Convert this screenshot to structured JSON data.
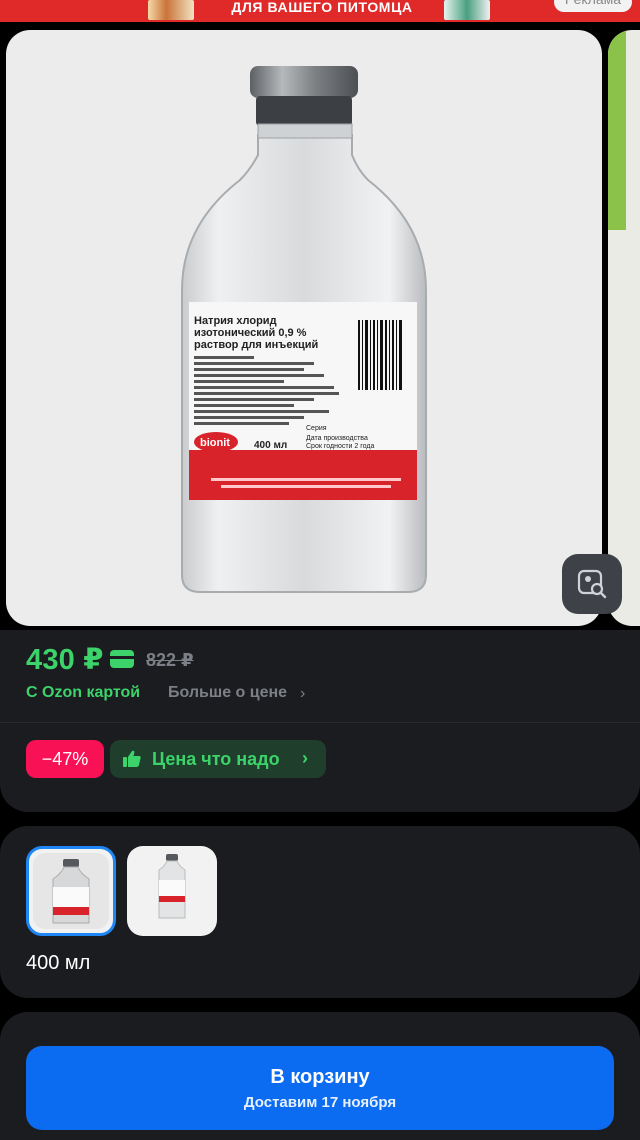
{
  "ad_banner": {
    "text": "ДЛЯ ВАШЕГО ПИТОМЦА",
    "label": "Реклама"
  },
  "product_image": {
    "label_title": "Натрия хлорид изотонический 0,9 % раствор для инъекций",
    "label_lines": [
      "МНН натрия хлорид",
      "Для внутривенного и подкожного введения",
      "Для ветеринарного применения",
      "Стерильно",
      "100 мл содержит: ДВ - натрия хлорид - 0,9 г",
      "и воду для инъекций до 100 мл",
      "Отпускается без рецепта ветеринарного врача"
    ],
    "brand": "bionit",
    "volume": "400 мл",
    "label_right": [
      "Серия",
      "Дата производства",
      "Срок годности",
      "2 года"
    ]
  },
  "price": {
    "current": "430 ₽",
    "old": "822 ₽",
    "ozon_card_label": "С Ozon картой",
    "more_price_label": "Больше о цене",
    "discount": "−47%",
    "good_price_label": "Цена что надо"
  },
  "variants": {
    "selected_label": "400 мл"
  },
  "cart": {
    "button_label": "В корзину",
    "delivery_label": "Доставим 17 ноября"
  },
  "colors": {
    "accent_green": "#3cd36a",
    "discount_pink": "#f91155",
    "primary_blue": "#0b6cf2",
    "panel_bg": "#1b1c1f"
  }
}
